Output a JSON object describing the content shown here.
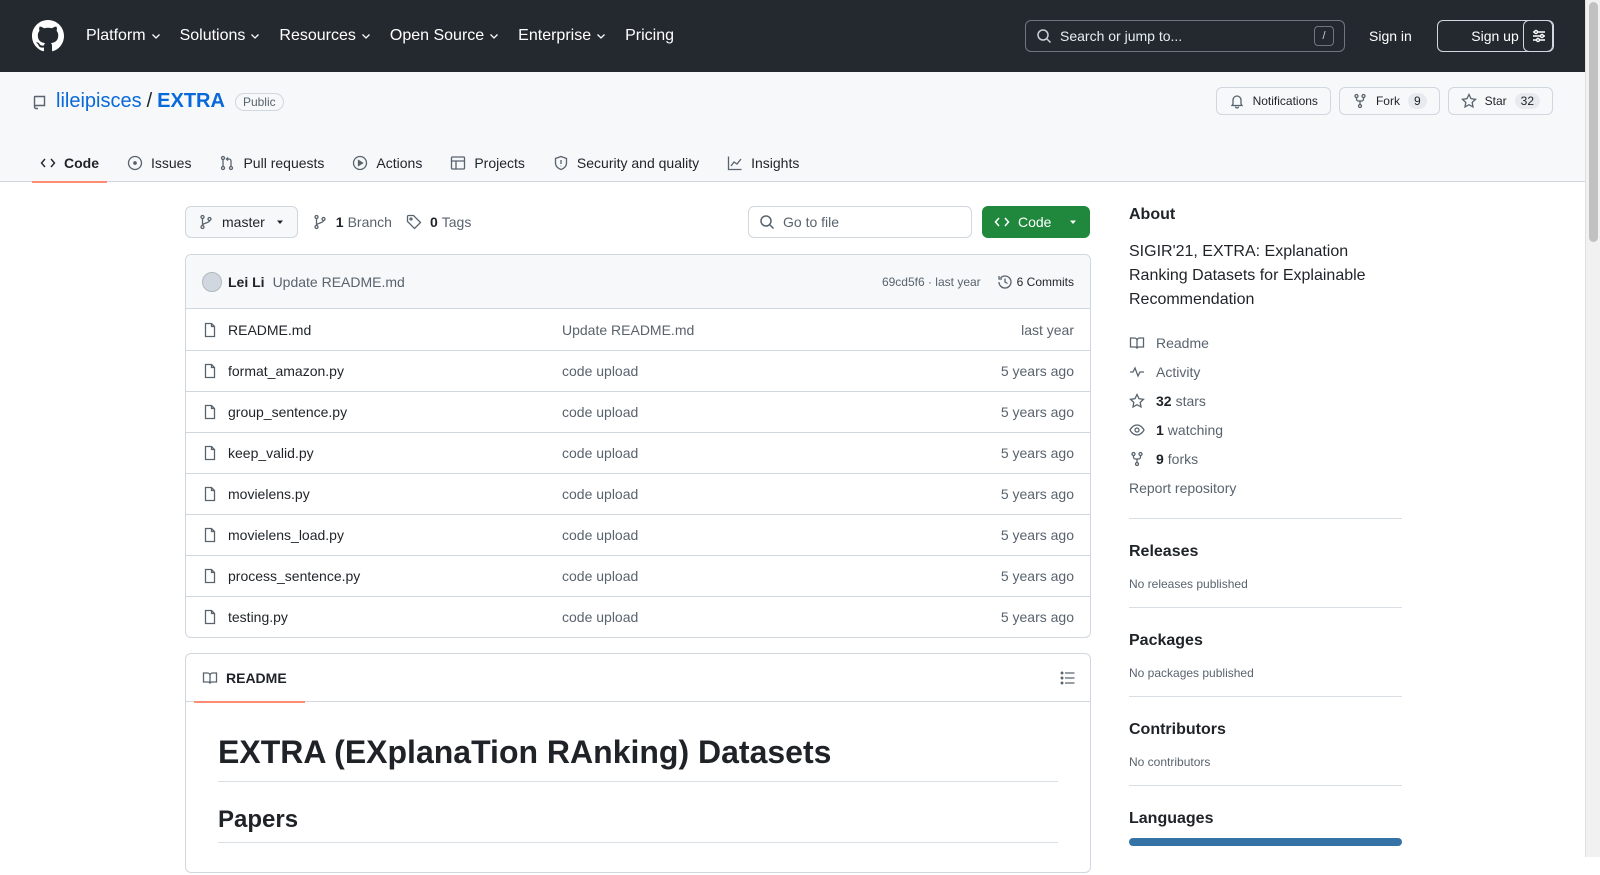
{
  "header": {
    "nav": [
      "Platform",
      "Solutions",
      "Resources",
      "Open Source",
      "Enterprise",
      "Pricing"
    ],
    "search_placeholder": "Search or jump to...",
    "search_shortcut": "/",
    "signin": "Sign in",
    "signup": "Sign up"
  },
  "repo": {
    "owner": "lileipisces",
    "separator": "/",
    "name": "EXTRA",
    "visibility": "Public",
    "notifications": "Notifications",
    "fork_label": "Fork",
    "fork_count": "9",
    "star_label": "Star",
    "star_count": "32"
  },
  "tabs": [
    "Code",
    "Issues",
    "Pull requests",
    "Actions",
    "Projects",
    "Security and quality",
    "Insights"
  ],
  "branch": {
    "name": "master",
    "branch_count": "1",
    "branch_label": "Branch",
    "tag_count": "0",
    "tag_label": "Tags",
    "goto_placeholder": "Go to file",
    "code_button": "Code"
  },
  "commit": {
    "author": "Lei Li",
    "message": "Update README.md",
    "hash_time": "69cd5f6 · last year",
    "commits": "6 Commits"
  },
  "files": [
    {
      "name": "README.md",
      "message": "Update README.md",
      "age": "last year"
    },
    {
      "name": "format_amazon.py",
      "message": "code upload",
      "age": "5 years ago"
    },
    {
      "name": "group_sentence.py",
      "message": "code upload",
      "age": "5 years ago"
    },
    {
      "name": "keep_valid.py",
      "message": "code upload",
      "age": "5 years ago"
    },
    {
      "name": "movielens.py",
      "message": "code upload",
      "age": "5 years ago"
    },
    {
      "name": "movielens_load.py",
      "message": "code upload",
      "age": "5 years ago"
    },
    {
      "name": "process_sentence.py",
      "message": "code upload",
      "age": "5 years ago"
    },
    {
      "name": "testing.py",
      "message": "code upload",
      "age": "5 years ago"
    }
  ],
  "readme": {
    "tab": "README",
    "h1": "EXTRA (EXplanaTion RAnking) Datasets",
    "h2": "Papers"
  },
  "sidebar": {
    "about_title": "About",
    "about_text": "SIGIR'21, EXTRA: Explanation Ranking Datasets for Explainable Recommendation",
    "readme": "Readme",
    "activity": "Activity",
    "stars_count": "32",
    "stars_label": "stars",
    "watching_count": "1",
    "watching_label": "watching",
    "forks_count": "9",
    "forks_label": "forks",
    "report": "Report repository",
    "releases_title": "Releases",
    "releases_text": "No releases published",
    "packages_title": "Packages",
    "packages_text": "No packages published",
    "contributors_title": "Contributors",
    "contributors_text": "No contributors",
    "languages_title": "Languages"
  },
  "colors": {
    "header_bg": "#24292f",
    "accent_link": "#0969da",
    "code_button": "#1f883d",
    "tab_underline": "#fd8c73",
    "language_python": "#3572a5"
  }
}
